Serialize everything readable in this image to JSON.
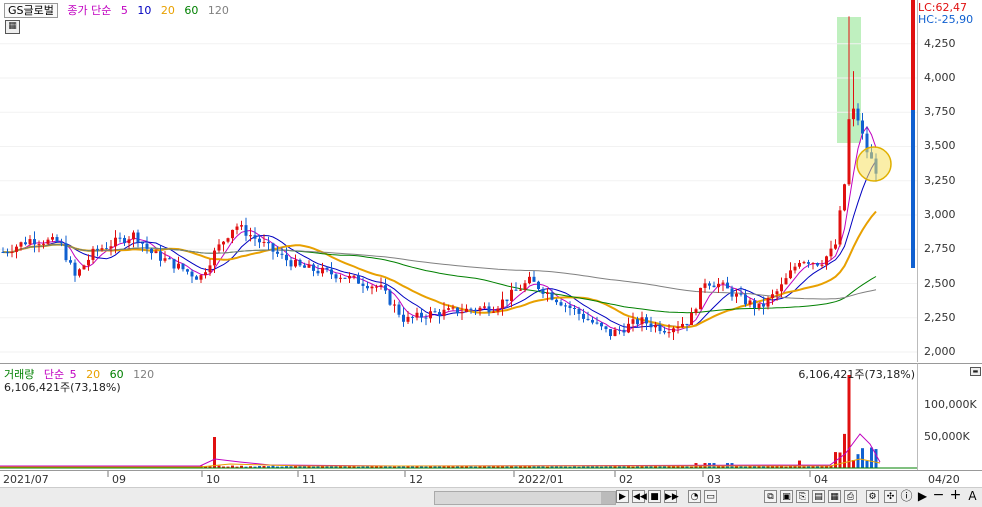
{
  "stock": {
    "name": "GS글로벌"
  },
  "price_legend": {
    "label": "종가 단순",
    "periods": [
      "5",
      "10",
      "20",
      "60",
      "120"
    ],
    "colors": [
      "#c000c0",
      "#0000c0",
      "#e8a000",
      "#008000",
      "#808080"
    ]
  },
  "volume_legend": {
    "label": "거래량",
    "type": "단순",
    "periods": [
      "5",
      "20",
      "60",
      "120"
    ]
  },
  "price_axis": {
    "lc_label": "LC:62,47",
    "hc_label": "HC:-25,90",
    "ticks": [
      "4,250",
      "4,000",
      "3,750",
      "3,500",
      "3,250",
      "3,000",
      "2,750",
      "2,500",
      "2,250",
      "2,000"
    ]
  },
  "volume_axis": {
    "ticks": [
      "100,000K",
      "50,000K"
    ]
  },
  "volume_info_left": "6,106,421주(73,18%)",
  "volume_info_right": "6,106,421주(73,18%)",
  "time_axis": {
    "labels": [
      "2021/07",
      "09",
      "10",
      "11",
      "12",
      "2022/01",
      "02",
      "03",
      "04"
    ],
    "right_label": "04/20"
  },
  "colors": {
    "up": "#e01010",
    "down": "#1060d0",
    "highlight_box": "#bff0bf",
    "circle": "#f5d020"
  }
}
